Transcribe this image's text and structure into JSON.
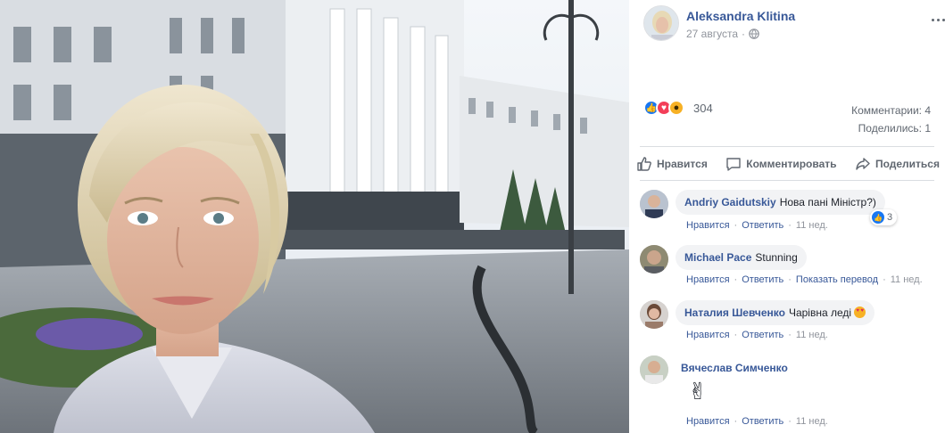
{
  "post": {
    "author": "Aleksandra Klitina",
    "date": "27 августа",
    "meta_separator": "·",
    "privacy_icon": "globe-icon",
    "menu_icon": "more-horizontal-icon"
  },
  "reactions": {
    "icons": [
      "like-reaction-icon",
      "love-reaction-icon",
      "wow-reaction-icon"
    ],
    "count": "304",
    "comments": "Комментарии: 4",
    "shares": "Поделились: 1"
  },
  "actions": {
    "like": "Нравится",
    "comment": "Комментировать",
    "share": "Поделиться"
  },
  "comments": [
    {
      "name": "Andriy Gaidutskiy",
      "text": "Нова пані Міністр?)",
      "like_label": "Нравится",
      "reply_label": "Ответить",
      "time": "11 нед.",
      "reaction_count": "3"
    },
    {
      "name": "Michael Pace",
      "text": "Stunning",
      "like_label": "Нравится",
      "reply_label": "Ответить",
      "translate_label": "Показать перевод",
      "time": "11 нед."
    },
    {
      "name": "Наталия Шевченко",
      "text": "Чарівна леді",
      "like_label": "Нравится",
      "reply_label": "Ответить",
      "time": "11 нед."
    },
    {
      "name": "Вячеслав Симченко",
      "text": "✌",
      "like_label": "Нравится",
      "reply_label": "Ответить",
      "time": "11 нед."
    }
  ],
  "colors": {
    "link_blue": "#385898",
    "meta_gray": "#90949c",
    "like_blue": "#1877f2",
    "love_red": "#f33e58",
    "wow_yellow": "#f7b125"
  }
}
